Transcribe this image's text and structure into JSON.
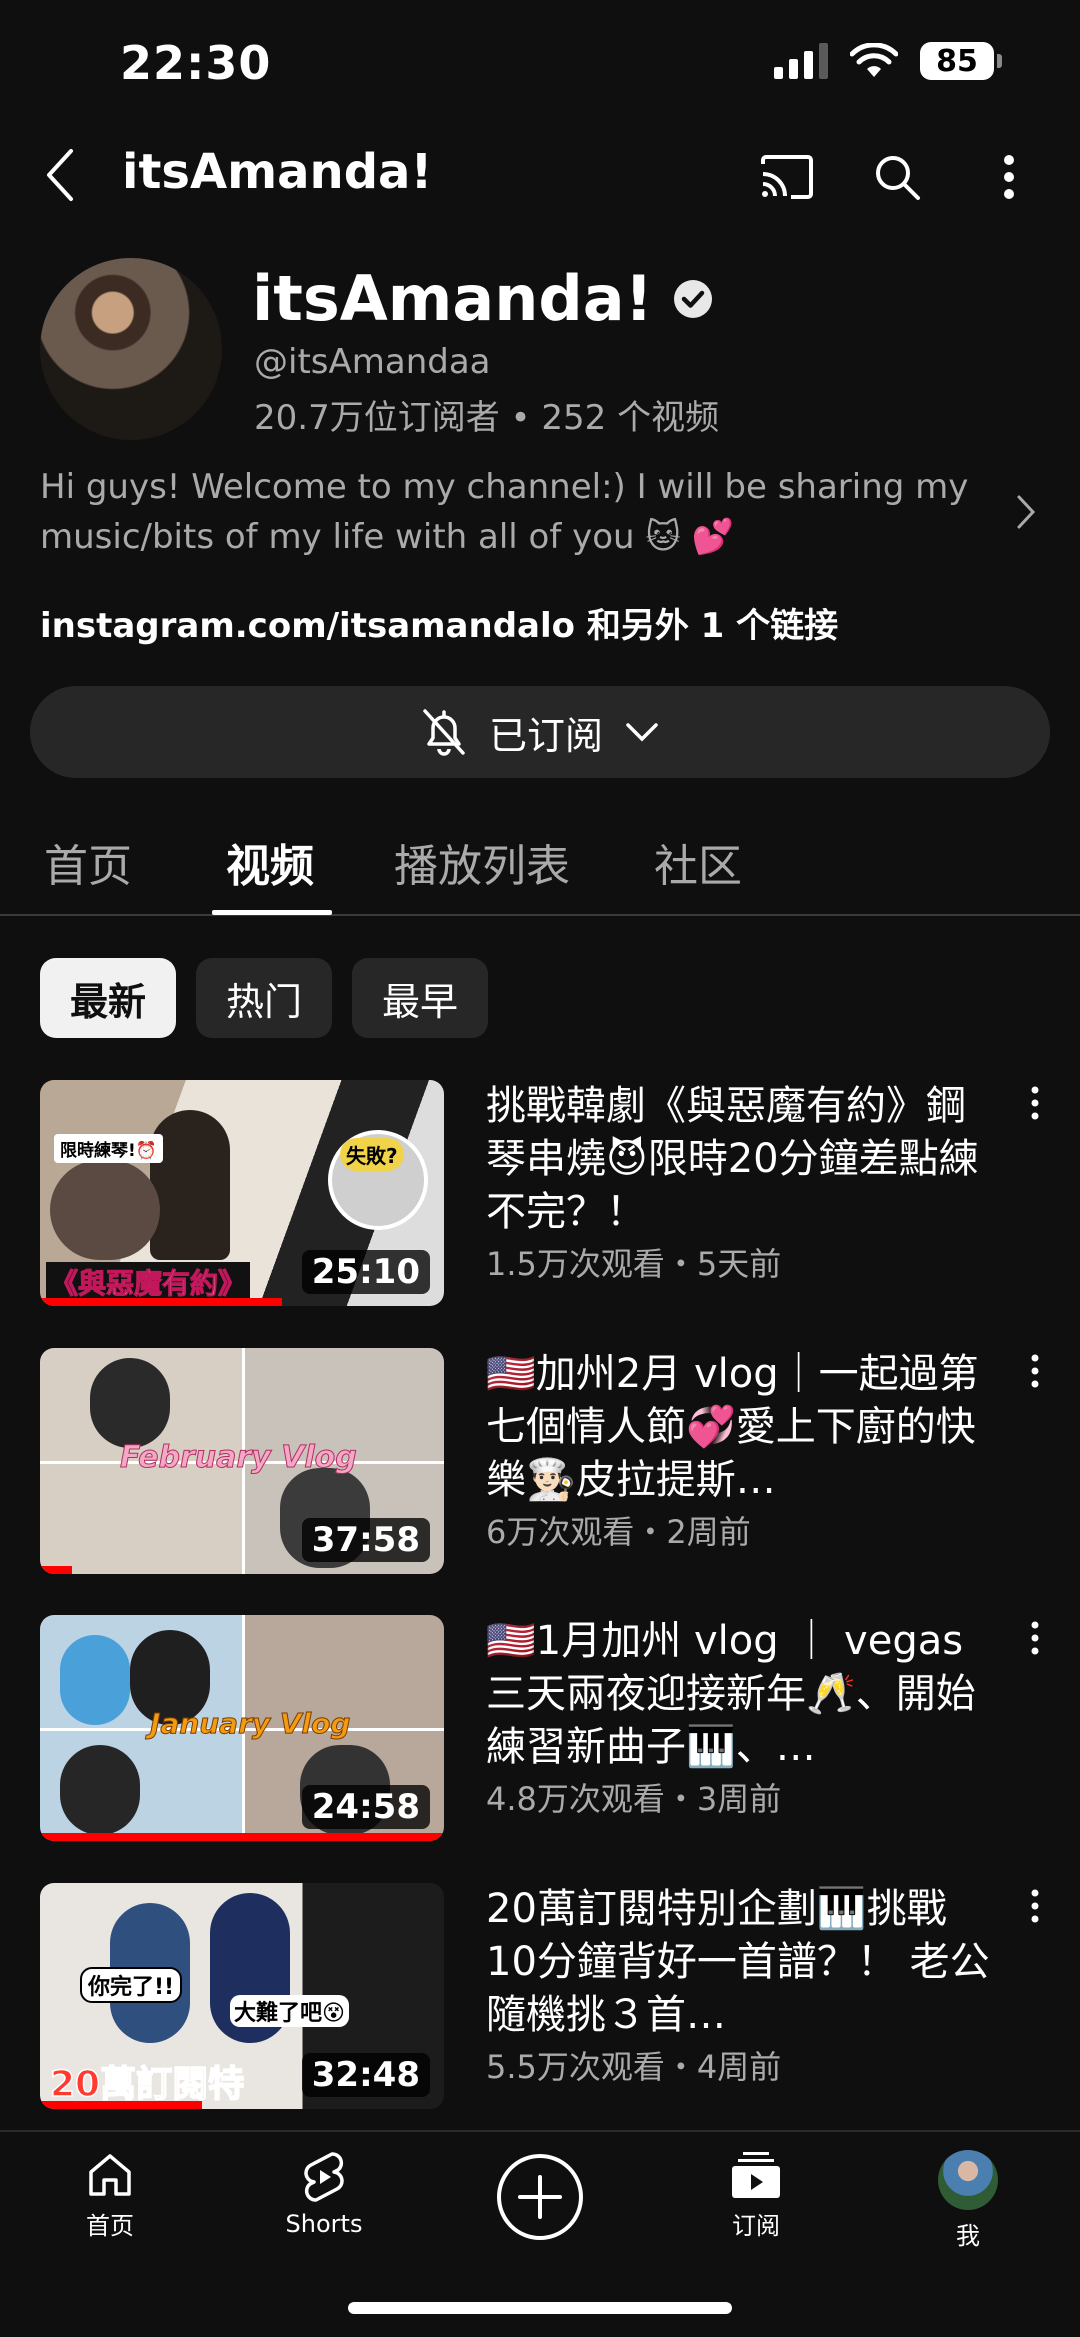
{
  "status_bar": {
    "time": "22:30",
    "battery": "85"
  },
  "app_bar": {
    "title": "itsAmanda!"
  },
  "channel": {
    "name": "itsAmanda!",
    "handle": "@itsAmandaa",
    "stats": "20.7万位订阅者 • 252 个视频",
    "description": "Hi guys! Welcome to my channel:) I will be sharing my music/bits of my life with all of you 🐱 💕",
    "link": "instagram.com/itsamandalo 和另外 1 个链接",
    "subscribe_label": "已订阅"
  },
  "tabs": [
    "首页",
    "视频",
    "播放列表",
    "社区"
  ],
  "chips": [
    "最新",
    "热门",
    "最早"
  ],
  "videos": [
    {
      "title": "挑戰韓劇《與惡魔有約》鋼琴串燒😈限時20分鐘差點練不完？！",
      "meta": "1.5万次观看・5天前",
      "duration": "25:10",
      "progress": 0.6,
      "overlay": "《與惡魔有約》",
      "tag1": "限時練琴!⏰",
      "tag2": "失敗?"
    },
    {
      "title": "🇺🇸加州2月 vlog｜一起過第七個情人節💞愛上下廚的快樂👨🏻‍🍳皮拉提斯…",
      "meta": "6万次观看・2周前",
      "duration": "37:58",
      "progress": 0.08,
      "overlay": "February Vlog"
    },
    {
      "title": "🇺🇸1月加州 vlog ｜ vegas 三天兩夜迎接新年🥂、開始練習新曲子🎹、…",
      "meta": "4.8万次观看・3周前",
      "duration": "24:58",
      "progress": 1.0,
      "overlay": "January Vlog"
    },
    {
      "title": "20萬訂閱特別企劃🎹挑戰10分鐘背好一首譜？！ 老公隨機挑３首…",
      "meta": "5.5万次观看・4周前",
      "duration": "32:48",
      "progress": 0.4,
      "overlay": "20萬訂閱特",
      "tag1": "你完了!!",
      "tag2": "大難了吧😵"
    }
  ],
  "bottom_nav": {
    "home": "首页",
    "shorts": "Shorts",
    "subscriptions": "订阅",
    "me": "我"
  },
  "colors": {
    "background": "#0f0f0f",
    "accent_red": "#ff0000",
    "secondary_text": "#aaaaaa",
    "chip_bg": "#272727"
  }
}
